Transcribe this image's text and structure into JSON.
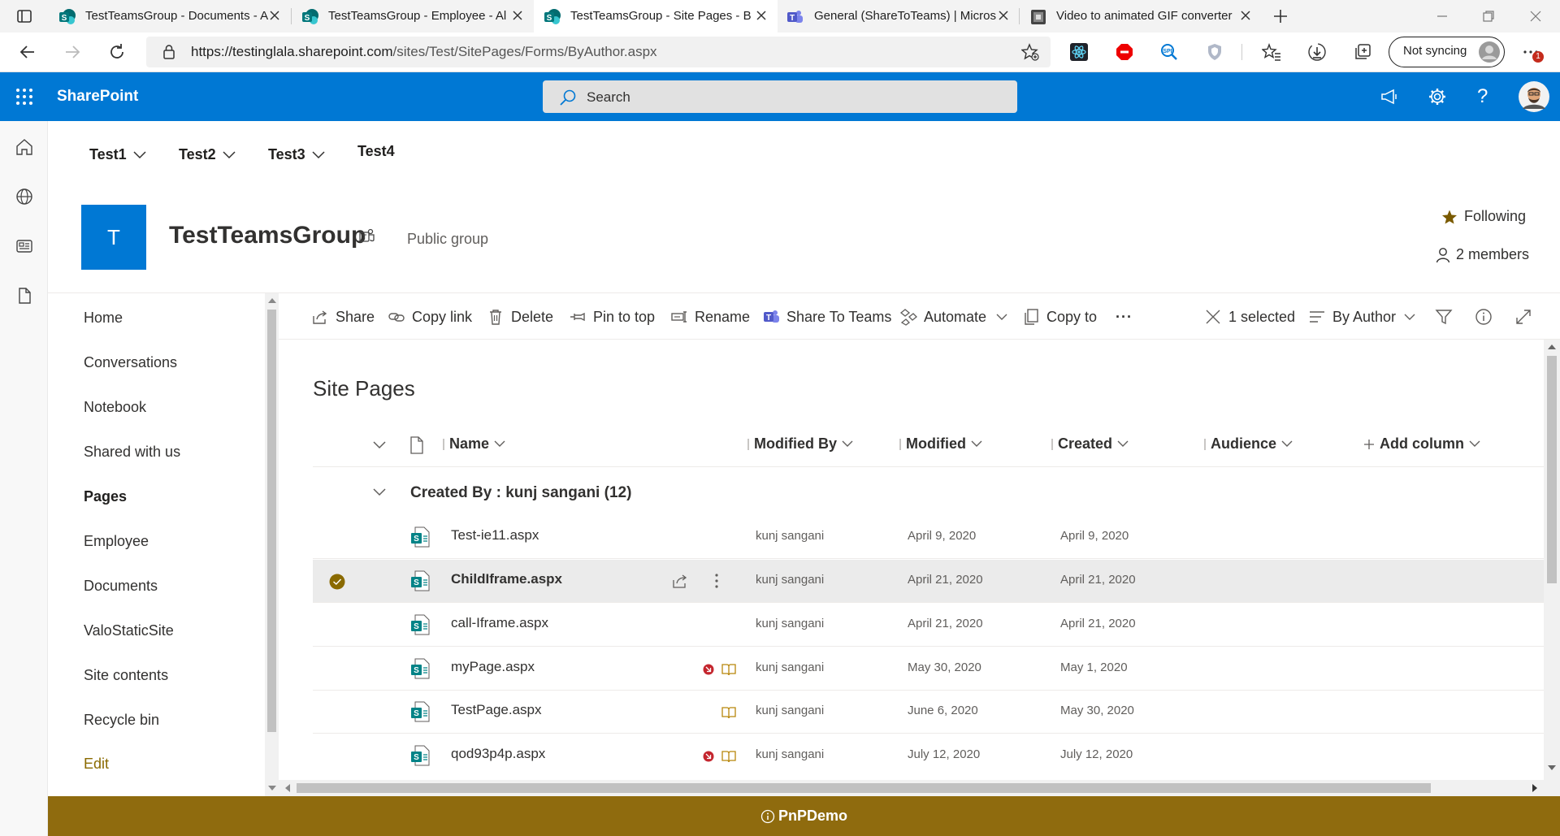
{
  "browser": {
    "tabs": [
      {
        "title": "TestTeamsGroup - Documents - A"
      },
      {
        "title": "TestTeamsGroup - Employee - Al"
      },
      {
        "title": "TestTeamsGroup - Site Pages - B"
      },
      {
        "title": "General (ShareToTeams) | Micros"
      },
      {
        "title": "Video to animated GIF converter"
      }
    ],
    "url_host": "https://testinglala.sharepoint.com",
    "url_path": "/sites/Test/SitePages/Forms/ByAuthor.aspx",
    "sync_label": "Not syncing",
    "badge_count": "1"
  },
  "suite": {
    "brand": "SharePoint",
    "search_placeholder": "Search"
  },
  "hubnav": [
    "Test1",
    "Test2",
    "Test3",
    "Test4"
  ],
  "site": {
    "logo_letter": "T",
    "title": "TestTeamsGroup",
    "type": "Public group",
    "following": "Following",
    "members": "2 members"
  },
  "quicklaunch": [
    {
      "label": "Home"
    },
    {
      "label": "Conversations"
    },
    {
      "label": "Notebook"
    },
    {
      "label": "Shared with us"
    },
    {
      "label": "Pages"
    },
    {
      "label": "Employee"
    },
    {
      "label": "Documents"
    },
    {
      "label": "ValoStaticSite"
    },
    {
      "label": "Site contents"
    },
    {
      "label": "Recycle bin"
    },
    {
      "label": "Edit"
    }
  ],
  "commands": {
    "share": "Share",
    "copy_link": "Copy link",
    "delete": "Delete",
    "pin": "Pin to top",
    "rename": "Rename",
    "share_teams": "Share To Teams",
    "automate": "Automate",
    "copy_to": "Copy to",
    "more": "···",
    "selected": "1 selected",
    "view": "By Author"
  },
  "list": {
    "title": "Site Pages",
    "columns": {
      "name": "Name",
      "modified_by": "Modified By",
      "modified": "Modified",
      "created": "Created",
      "audience": "Audience",
      "add_column": "Add column"
    },
    "group_header": "Created By : kunj sangani (12)",
    "rows": [
      {
        "name": "Test-ie11.aspx",
        "modified_by": "kunj sangani",
        "modified": "April 9, 2020",
        "created": "April 9, 2020"
      },
      {
        "name": "ChildIframe.aspx",
        "modified_by": "kunj sangani",
        "modified": "April 21, 2020",
        "created": "April 21, 2020"
      },
      {
        "name": "call-Iframe.aspx",
        "modified_by": "kunj sangani",
        "modified": "April 21, 2020",
        "created": "April 21, 2020"
      },
      {
        "name": "myPage.aspx",
        "modified_by": "kunj sangani",
        "modified": "May 30, 2020",
        "created": "May 1, 2020"
      },
      {
        "name": "TestPage.aspx",
        "modified_by": "kunj sangani",
        "modified": "June 6, 2020",
        "created": "May 30, 2020"
      },
      {
        "name": "qod93p4p.aspx",
        "modified_by": "kunj sangani",
        "modified": "July 12, 2020",
        "created": "July 12, 2020"
      }
    ]
  },
  "footer": {
    "label": "PnPDemo"
  },
  "colors": {
    "suite": "#0078d4",
    "footer": "#8f6b0e",
    "accent": "#8a6a00"
  }
}
